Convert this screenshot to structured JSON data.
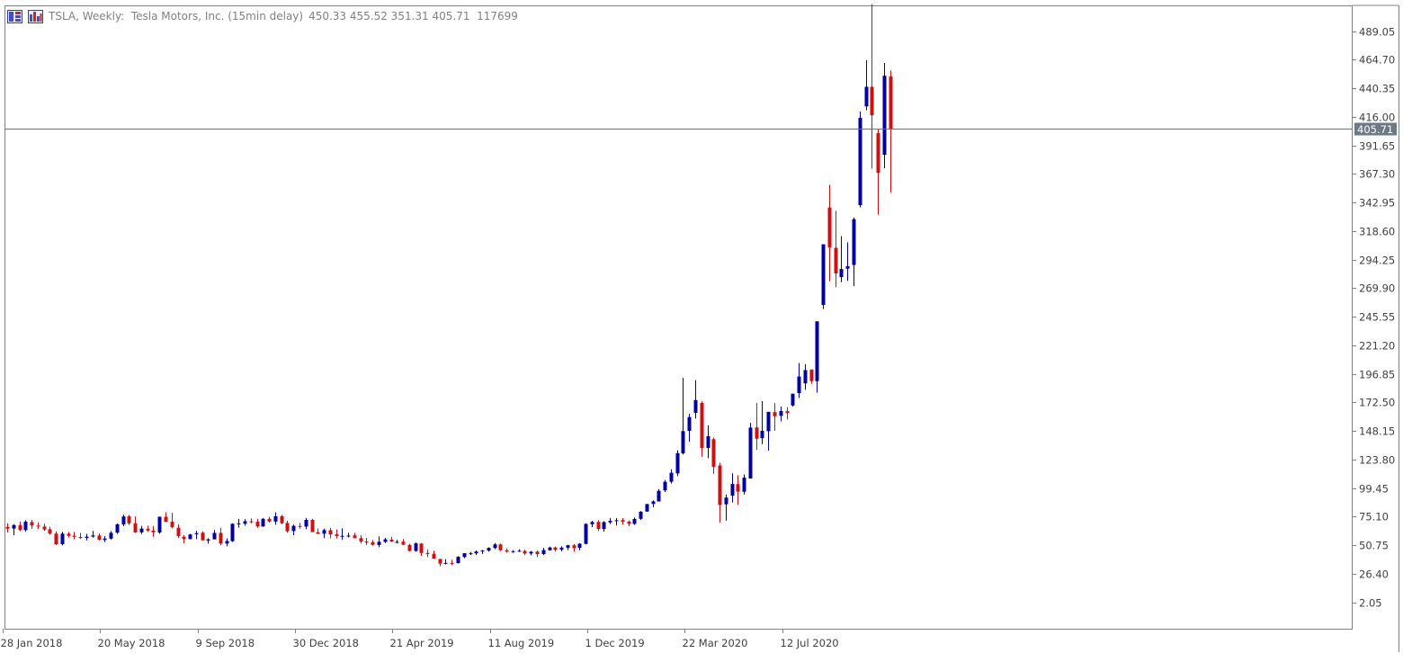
{
  "header": {
    "symbol_text": "TSLA, Weekly:  Tesla Motors, Inc. (15min delay)",
    "ohlcv_text": "450.33 455.52 351.31 405.71  117699"
  },
  "chart_data": {
    "type": "candlestick",
    "title": "TSLA, Weekly:  Tesla Motors, Inc. (15min delay)",
    "ylim": [
      -20.5,
      511.0
    ],
    "y_ticks": [
      "489.05",
      "464.70",
      "440.35",
      "416.00",
      "391.65",
      "367.30",
      "342.95",
      "318.60",
      "294.25",
      "269.90",
      "245.55",
      "221.20",
      "196.85",
      "172.50",
      "148.15",
      "123.80",
      "99.45",
      "75.10",
      "50.75",
      "26.40",
      "2.05"
    ],
    "x_ticks": [
      {
        "label": "28 Jan 2018",
        "index": 0
      },
      {
        "label": "20 May 2018",
        "index": 16
      },
      {
        "label": "9 Sep 2018",
        "index": 32
      },
      {
        "label": "30 Dec 2018",
        "index": 48
      },
      {
        "label": "21 Apr 2019",
        "index": 64
      },
      {
        "label": "11 Aug 2019",
        "index": 80
      },
      {
        "label": "1 Dec 2019",
        "index": 96
      },
      {
        "label": "22 Mar 2020",
        "index": 112
      },
      {
        "label": "12 Jul 2020",
        "index": 128
      }
    ],
    "last_price": 405.71,
    "colors": {
      "up": "#0000a0",
      "down": "#d01010",
      "axis": "#808080",
      "text": "#404040",
      "last_label_bg": "#6c7a86"
    },
    "candles": [
      [
        66.3,
        69.5,
        61.6,
        64.8
      ],
      [
        64.9,
        68.8,
        59.2,
        67.9
      ],
      [
        67.8,
        70.9,
        62.7,
        63.6
      ],
      [
        63.6,
        72.0,
        62.3,
        70.8
      ],
      [
        70.4,
        72.3,
        64.5,
        67.5
      ],
      [
        67.4,
        70.2,
        64.4,
        66.6
      ],
      [
        66.6,
        69.0,
        63.0,
        64.1
      ],
      [
        64.3,
        66.5,
        59.6,
        60.6
      ],
      [
        60.6,
        62.4,
        50.9,
        51.5
      ],
      [
        51.6,
        62.1,
        50.5,
        60.6
      ],
      [
        60.5,
        62.0,
        57.3,
        58.7
      ],
      [
        58.8,
        61.9,
        55.7,
        57.9
      ],
      [
        57.7,
        61.3,
        56.0,
        56.8
      ],
      [
        56.9,
        60.4,
        54.9,
        58.0
      ],
      [
        58.0,
        62.9,
        57.2,
        59.0
      ],
      [
        59.0,
        60.8,
        54.9,
        55.3
      ],
      [
        55.2,
        58.4,
        53.4,
        56.4
      ],
      [
        56.3,
        62.8,
        55.6,
        61.3
      ],
      [
        61.4,
        69.2,
        60.3,
        68.5
      ],
      [
        68.4,
        76.8,
        66.9,
        75.2
      ],
      [
        75.3,
        76.6,
        68.0,
        69.4
      ],
      [
        69.3,
        75.2,
        61.3,
        61.6
      ],
      [
        61.7,
        67.2,
        60.2,
        64.9
      ],
      [
        64.8,
        67.4,
        62.2,
        63.3
      ],
      [
        63.1,
        67.0,
        57.8,
        61.7
      ],
      [
        61.5,
        75.1,
        60.5,
        75.0
      ],
      [
        74.9,
        78.8,
        70.6,
        70.6
      ],
      [
        70.7,
        78.3,
        65.0,
        66.0
      ],
      [
        65.6,
        68.5,
        57.0,
        58.4
      ],
      [
        58.0,
        59.4,
        52.3,
        56.0
      ],
      [
        55.9,
        60.4,
        55.8,
        59.9
      ],
      [
        60.1,
        63.0,
        55.9,
        61.0
      ],
      [
        61.4,
        62.4,
        54.8,
        54.9
      ],
      [
        54.7,
        56.7,
        52.0,
        55.7
      ],
      [
        55.7,
        63.7,
        55.8,
        61.2
      ],
      [
        61.2,
        65.7,
        50.8,
        52.1
      ],
      [
        52.1,
        56.6,
        49.9,
        54.3
      ],
      [
        54.1,
        69.3,
        53.5,
        69.0
      ],
      [
        69.0,
        73.2,
        65.8,
        69.4
      ],
      [
        69.0,
        73.0,
        67.4,
        71.2
      ],
      [
        71.1,
        73.5,
        69.2,
        71.0
      ],
      [
        70.8,
        73.3,
        65.6,
        66.7
      ],
      [
        66.7,
        73.9,
        66.4,
        73.2
      ],
      [
        73.2,
        74.9,
        70.1,
        70.9
      ],
      [
        70.9,
        78.7,
        68.2,
        75.4
      ],
      [
        75.4,
        76.5,
        68.6,
        69.5
      ],
      [
        69.7,
        71.5,
        61.4,
        62.6
      ],
      [
        62.8,
        68.3,
        59.3,
        67.2
      ],
      [
        67.1,
        69.7,
        64.7,
        66.6
      ],
      [
        66.6,
        73.9,
        64.4,
        72.3
      ],
      [
        72.3,
        73.2,
        61.9,
        61.9
      ],
      [
        61.8,
        64.9,
        60.3,
        60.4
      ],
      [
        60.5,
        64.9,
        56.8,
        63.6
      ],
      [
        63.5,
        65.6,
        56.6,
        59.9
      ],
      [
        59.9,
        64.2,
        56.5,
        58.5
      ],
      [
        58.3,
        65.1,
        55.3,
        58.7
      ],
      [
        58.6,
        61.3,
        57.3,
        58.9
      ],
      [
        59.1,
        61.3,
        56.6,
        56.7
      ],
      [
        56.7,
        59.5,
        52.1,
        53.8
      ],
      [
        53.8,
        57.0,
        50.7,
        53.3
      ],
      [
        53.3,
        55.1,
        50.4,
        51.0
      ],
      [
        50.9,
        58.2,
        49.0,
        53.6
      ],
      [
        53.5,
        56.9,
        52.6,
        55.7
      ],
      [
        55.5,
        57.8,
        53.4,
        53.8
      ],
      [
        53.6,
        55.3,
        52.2,
        53.6
      ],
      [
        53.7,
        56.0,
        50.9,
        51.1
      ],
      [
        51.0,
        52.0,
        45.5,
        45.8
      ],
      [
        45.8,
        53.0,
        45.2,
        52.3
      ],
      [
        52.1,
        52.6,
        41.5,
        44.1
      ],
      [
        44.1,
        47.1,
        40.6,
        43.2
      ],
      [
        43.4,
        46.0,
        40.3,
        39.2
      ],
      [
        39.0,
        38.6,
        32.8,
        35.0
      ],
      [
        35.0,
        38.7,
        34.3,
        35.6
      ],
      [
        35.6,
        38.4,
        33.8,
        35.3
      ],
      [
        35.4,
        41.2,
        35.1,
        40.9
      ],
      [
        40.6,
        44.0,
        39.6,
        43.9
      ],
      [
        43.5,
        45.0,
        42.3,
        43.8
      ],
      [
        43.8,
        46.2,
        42.3,
        45.3
      ],
      [
        45.5,
        46.7,
        43.3,
        46.1
      ],
      [
        46.1,
        48.9,
        45.2,
        48.4
      ],
      [
        48.3,
        52.6,
        47.4,
        51.4
      ],
      [
        51.3,
        52.1,
        45.7,
        46.4
      ],
      [
        46.4,
        48.0,
        44.3,
        45.3
      ],
      [
        45.4,
        46.5,
        44.1,
        45.6
      ],
      [
        45.6,
        47.3,
        44.9,
        46.0
      ],
      [
        45.8,
        46.9,
        42.3,
        43.7
      ],
      [
        43.6,
        45.8,
        42.0,
        45.1
      ],
      [
        45.2,
        46.2,
        40.6,
        43.1
      ],
      [
        43.2,
        48.4,
        42.3,
        46.6
      ],
      [
        46.4,
        49.5,
        46.0,
        48.8
      ],
      [
        48.8,
        49.5,
        45.5,
        46.9
      ],
      [
        46.9,
        49.9,
        45.5,
        48.6
      ],
      [
        48.5,
        51.0,
        46.5,
        50.7
      ],
      [
        50.6,
        51.6,
        45.1,
        48.2
      ],
      [
        48.5,
        52.4,
        46.4,
        52.0
      ],
      [
        51.8,
        69.2,
        51.5,
        68.9
      ],
      [
        68.6,
        71.5,
        66.2,
        70.5
      ],
      [
        70.6,
        72.1,
        62.7,
        64.6
      ],
      [
        64.5,
        71.2,
        62.2,
        70.4
      ],
      [
        70.2,
        73.9,
        68.8,
        71.5
      ],
      [
        71.6,
        73.8,
        67.5,
        72.0
      ],
      [
        72.1,
        73.8,
        68.2,
        70.7
      ],
      [
        70.8,
        71.8,
        66.9,
        68.9
      ],
      [
        68.9,
        74.3,
        68.0,
        73.1
      ],
      [
        73.2,
        79.8,
        72.2,
        79.3
      ],
      [
        79.4,
        85.9,
        79.3,
        85.8
      ],
      [
        85.9,
        89.0,
        83.0,
        88.1
      ],
      [
        88.0,
        98.6,
        88.0,
        97.1
      ],
      [
        97.4,
        106.3,
        96.0,
        104.8
      ],
      [
        104.8,
        115.4,
        103.3,
        112.5
      ],
      [
        111.9,
        131.7,
        109.7,
        129.2
      ],
      [
        129.0,
        193.4,
        128.0,
        148.0
      ],
      [
        148.2,
        162.8,
        139.0,
        160.0
      ],
      [
        163.6,
        191.4,
        158.8,
        174.5
      ],
      [
        172.0,
        173.4,
        126.1,
        133.6
      ],
      [
        133.6,
        152.9,
        124.8,
        143.7
      ],
      [
        141.1,
        142.5,
        111.5,
        117.6
      ],
      [
        118.7,
        121.0,
        70.1,
        85.0
      ],
      [
        85.6,
        94.0,
        71.6,
        91.3
      ],
      [
        92.9,
        112.0,
        87.2,
        102.9
      ],
      [
        102.8,
        110.4,
        85.1,
        96.4
      ],
      [
        96.3,
        111.0,
        94.0,
        108.3
      ],
      [
        107.6,
        155.0,
        107.5,
        151.0
      ],
      [
        151.1,
        172.0,
        132.1,
        141.5
      ],
      [
        142.0,
        173.5,
        136.8,
        148.3
      ],
      [
        147.9,
        161.8,
        131.4,
        164.4
      ],
      [
        164.2,
        171.8,
        148.3,
        160.7
      ],
      [
        161.0,
        168.8,
        156.3,
        165.1
      ],
      [
        165.0,
        168.5,
        157.9,
        163.4
      ],
      [
        169.8,
        172.9,
        169.0,
        179.9
      ],
      [
        180.4,
        206.0,
        176.2,
        194.5
      ],
      [
        188.7,
        205.1,
        183.2,
        200.0
      ],
      [
        200.5,
        200.6,
        188.4,
        190.6
      ],
      [
        190.6,
        205.6,
        180.8,
        241.6
      ],
      [
        255.6,
        259.0,
        252.1,
        307.3
      ],
      [
        338.7,
        358.0,
        275.8,
        304.5
      ],
      [
        304.3,
        335.8,
        270.7,
        282.4
      ],
      [
        279.3,
        314.2,
        275.0,
        286.2
      ],
      [
        286.5,
        308.9,
        276.1,
        288.6
      ],
      [
        289.7,
        330.2,
        271.6,
        328.7
      ],
      [
        340.7,
        420.5,
        338.8,
        415.2
      ],
      [
        424.9,
        464.3,
        421.6,
        441.6
      ],
      [
        441.6,
        512.1,
        371.8,
        417.3
      ],
      [
        402.0,
        405.3,
        332.6,
        368.2
      ],
      [
        383.6,
        461.9,
        372.1,
        451.0
      ],
      [
        450.33,
        455.52,
        351.31,
        405.71
      ]
    ]
  }
}
